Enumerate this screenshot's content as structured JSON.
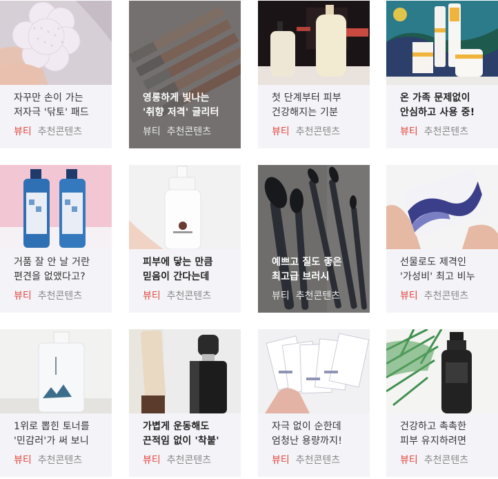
{
  "cards": [
    {
      "title": [
        "자꾸만 손이 가는",
        "저자극 '닦토' 패드"
      ],
      "category": "뷰티",
      "tag": "추천콘텐츠"
    },
    {
      "title": [
        "영롱하게 빛나는",
        "'취향 저격' 글리터"
      ],
      "category": "뷰티",
      "tag": "추천콘텐츠"
    },
    {
      "title": [
        "첫 단계부터 피부",
        "건강해지는 기분"
      ],
      "category": "뷰티",
      "tag": "추천콘텐츠"
    },
    {
      "title": [
        "온 가족 문제없이",
        "안심하고 사용 중!"
      ],
      "category": "뷰티",
      "tag": "추천콘텐츠"
    },
    {
      "title": [
        "거품 잘 안 날 거란",
        "편견을 없앴다고?"
      ],
      "category": "뷰티",
      "tag": "추천콘텐츠"
    },
    {
      "title": [
        "피부에 닿는 만큼",
        "믿음이 간다는데"
      ],
      "category": "뷰티",
      "tag": "추천콘텐츠"
    },
    {
      "title": [
        "예쁘고 질도 좋은",
        "최고급 브러시"
      ],
      "category": "뷰티",
      "tag": "추천콘텐츠"
    },
    {
      "title": [
        "선물로도 제격인",
        "'가성비' 최고 비누"
      ],
      "category": "뷰티",
      "tag": "추천콘텐츠"
    },
    {
      "title": [
        "1위로 뽑힌 토너를",
        "'민감러'가 써 보니"
      ],
      "category": "뷰티",
      "tag": "추천콘텐츠"
    },
    {
      "title": [
        "가볍게 운동해도",
        "끈적임 없이 '착붙'"
      ],
      "category": "뷰티",
      "tag": "추천콘텐츠"
    },
    {
      "title": [
        "자극 없이 순한데",
        "엄청난 용량까지!"
      ],
      "category": "뷰티",
      "tag": "추천콘텐츠"
    },
    {
      "title": [
        "건강하고 촉촉한",
        "피부 유지하려면"
      ],
      "category": "뷰티",
      "tag": "추천콘텐츠"
    }
  ],
  "images": [
    {
      "icon": "cotton-pad-photo"
    },
    {
      "icon": "glitter-tubes-photo"
    },
    {
      "icon": "serum-bottles-photo"
    },
    {
      "icon": "family-cream-photo"
    },
    {
      "icon": "shampoo-bottles-photo"
    },
    {
      "icon": "pump-bottle-photo"
    },
    {
      "icon": "makeup-brushes-photo"
    },
    {
      "icon": "marble-soap-photo"
    },
    {
      "icon": "toner-bottle-photo"
    },
    {
      "icon": "primer-bottles-photo"
    },
    {
      "icon": "sheet-pads-photo"
    },
    {
      "icon": "mist-spray-photo"
    }
  ]
}
